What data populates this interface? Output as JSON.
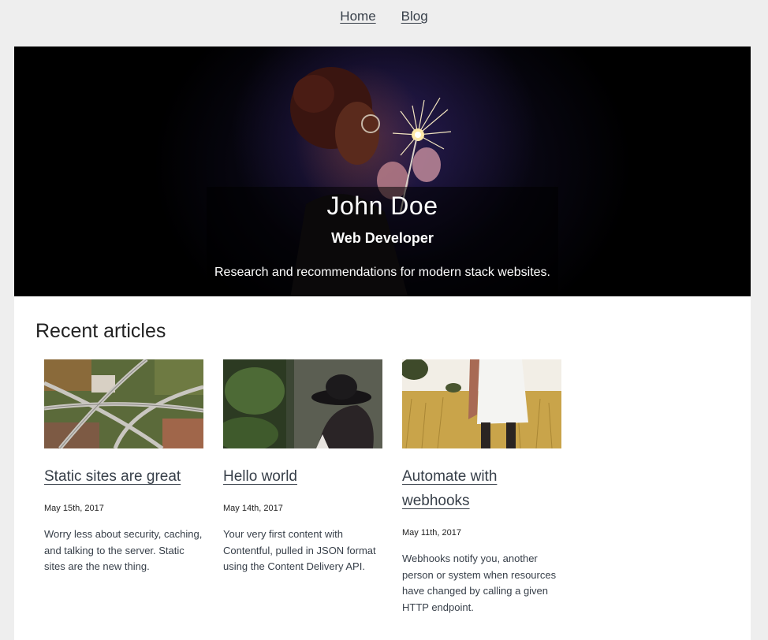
{
  "nav": {
    "items": [
      {
        "label": "Home"
      },
      {
        "label": "Blog"
      }
    ]
  },
  "hero": {
    "name": "John Doe",
    "title": "Web Developer",
    "tagline": "Research and recommendations for modern stack websites."
  },
  "section": {
    "heading": "Recent articles"
  },
  "articles": [
    {
      "title": "Static sites are great",
      "date": "May 15th, 2017",
      "description": "Worry less about security, caching, and talking to the server. Static sites are the new thing."
    },
    {
      "title": "Hello world",
      "date": "May 14th, 2017",
      "description": "Your very first content with Contentful, pulled in JSON format using the Content Delivery API."
    },
    {
      "title": "Automate with webhooks",
      "date": "May 11th, 2017",
      "description": "Webhooks notify you, another person or system when resources have changed by calling a given HTTP endpoint."
    }
  ]
}
